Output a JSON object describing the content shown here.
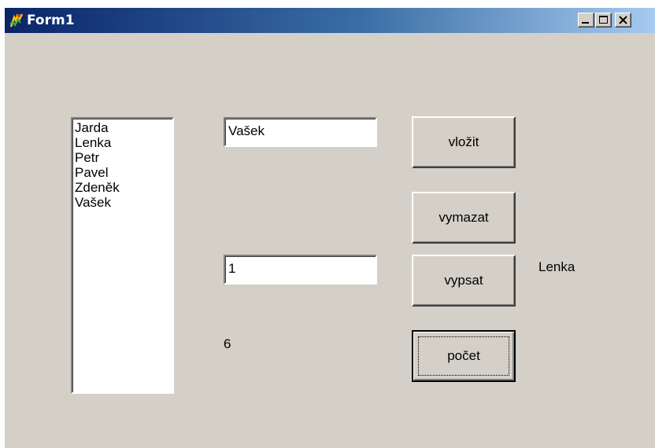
{
  "window": {
    "title": "Form1"
  },
  "titlebar": {
    "buttons": [
      "minimize-icon",
      "maximize-icon",
      "close-icon"
    ]
  },
  "listbox": {
    "items": [
      "Jarda",
      "Lenka",
      "Petr",
      "Pavel",
      "Zdeněk",
      "Vašek"
    ]
  },
  "edit_name": {
    "value": "Vašek"
  },
  "edit_index": {
    "value": "1"
  },
  "buttons": {
    "insert": "vložit",
    "delete": "vymazat",
    "print": "vypsat",
    "count": "počet"
  },
  "labels": {
    "output": "Lenka",
    "count": "6"
  }
}
